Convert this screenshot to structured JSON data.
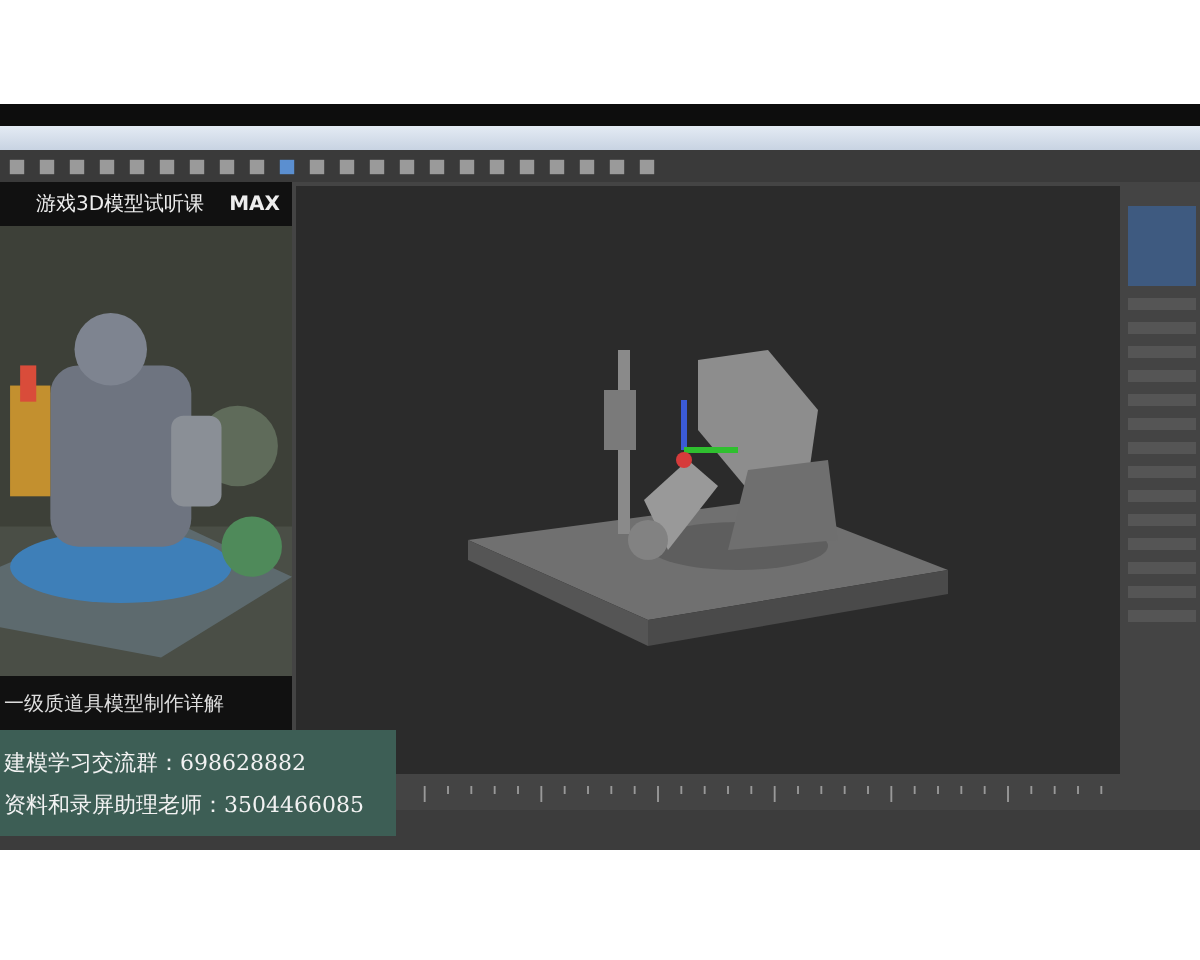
{
  "video_panel": {
    "title": "游戏3D模型试听课",
    "badge": "MAX",
    "caption": "一级质道具模型制作详解"
  },
  "overlay": {
    "lines": [
      "建模学习交流群：698628882",
      "资料和录屏助理老师：3504466085"
    ]
  }
}
